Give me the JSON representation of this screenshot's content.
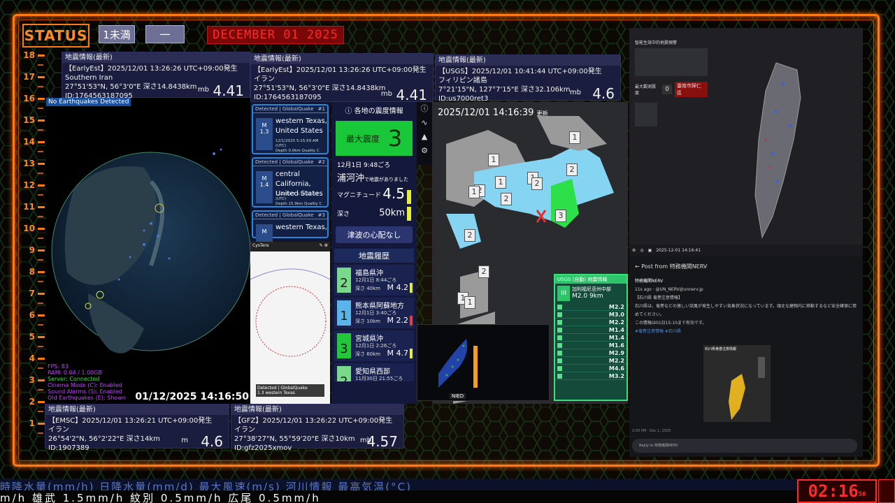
{
  "header": {
    "status_label": "STATUS",
    "level_label": "1未満",
    "dash_label": "一",
    "date": "DECEMBER 01 2025"
  },
  "ruler": [
    "18",
    "17",
    "16",
    "15",
    "14",
    "13",
    "12",
    "11",
    "10",
    "9",
    "8",
    "7",
    "6",
    "5",
    "4",
    "3",
    "2",
    "1"
  ],
  "quakes": [
    {
      "header": "地震情報(最新)",
      "source": "【EarlyEst】2025/12/01  13:26:26  UTC+09:00発生",
      "region": "Southern Iran",
      "coords": "27°51'53\"N,  56°3'0\"E  深さ14.8438km",
      "id": "ID:1764563187095",
      "mag_type": "mb",
      "mag": "4.41"
    },
    {
      "header": "地震情報(最新)",
      "source": "【EarlyEst】2025/12/01  13:26:26  UTC+09:00発生",
      "region": "イラン",
      "coords": "27°51'53\"N,  56°3'0\"E  深さ14.8438km",
      "id": "ID:1764563187095",
      "mag_type": "mb",
      "mag": "4.41"
    },
    {
      "header": "地震情報(最新)",
      "source": "【USGS】2025/12/01  10:41:44  UTC+09:00発生",
      "region": "フィリピン諸島",
      "coords": "7°21'15\"N,  127°7'15\"E  深さ32.106km",
      "id": "ID:us7000ret3",
      "mag_type": "mb",
      "mag": "4.6"
    },
    {
      "header": "地震情報(最新)",
      "source": "【EMSC】2025/12/01  13:26:21  UTC+09:00発生",
      "region": "イラン",
      "coords": "26°54'2\"N,  56°2'22\"E  深さ14km",
      "id": "ID:1907389",
      "mag_type": "m",
      "mag": "4.6"
    },
    {
      "header": "地震情報(最新)",
      "source": "【GFZ】2025/12/01  13:26:22  UTC+09:00発生",
      "region": "イラン",
      "coords": "27°38'27\"N,  55°59'20\"E  深さ10km",
      "id": "ID:gfz2025xmov",
      "mag_type": "mb",
      "mag": "4.57"
    }
  ],
  "globe": {
    "no_eq": "No Earthquakes Detected",
    "stats": [
      "FPS: 83",
      "RAM: 0.64 / 1.00GB",
      "Server: Connected",
      "Cinema Mode (C): Enabled",
      "Sound Alarms (S): Enabled",
      "Old Earthquakes (E): Shown"
    ],
    "time": "01/12/2025 14:16:50"
  },
  "globalquake": [
    {
      "head": "Detected | GlobalQuake",
      "num": "#1",
      "m": "M",
      "mag": "1.3",
      "place1": "western Texas,",
      "place2": "United States",
      "d1": "12/1/2025 5:15:59 AM (UTC)",
      "d2": "Depth 0.0km    Quality C"
    },
    {
      "head": "Detected | GlobalQuake",
      "num": "#2",
      "m": "M",
      "mag": "1.4",
      "place1": "central California,",
      "place2": "United States",
      "d1": "12/1/2025 5:10:21 AM (UTC)",
      "d2": "Depth 15.9km    Quality C"
    },
    {
      "head": "Detected | GlobalQuake",
      "num": "#3",
      "m": "M",
      "mag": "",
      "place1": "western Texas,",
      "place2": "",
      "d1": "",
      "d2": ""
    }
  ],
  "cystera": {
    "title": "CysTera",
    "foot_title": "Detected | GlobalQuake",
    "foot_place": "western Texas",
    "foot_mag": "1.3"
  },
  "jp": {
    "title": "各地の震度情報",
    "max_label": "最大震度",
    "max_value": "3",
    "date": "12月1日 9:48ごろ",
    "place": "浦河沖",
    "place_suffix": "で地震がありました",
    "mag_label": "マグニチュード",
    "mag_value": "4.5",
    "depth_label": "深さ",
    "depth_value": "50km",
    "tsunami": "津波の心配なし",
    "history_title": "地震履歴",
    "history": [
      {
        "shindo": "2",
        "name": "福島県沖",
        "time": "12月1日 8:44ごろ",
        "depth": "深さ  40km",
        "mag": "M 4.2",
        "color": "#7ad88a",
        "bar": "#e6ee3a"
      },
      {
        "shindo": "1",
        "name": "熊本県阿蘇地方",
        "time": "12月1日 3:40ごろ",
        "depth": "深さ  10km",
        "mag": "M 2.2",
        "color": "#5ab4ea",
        "bar": "#e04040"
      },
      {
        "shindo": "3",
        "name": "宮城県沖",
        "time": "12月1日 2:26ごろ",
        "depth": "深さ  60km",
        "mag": "M 4.7",
        "color": "#22c83a",
        "bar": "#e6ee3a"
      },
      {
        "shindo": "2",
        "name": "愛知県西部",
        "time": "11月30日 21:55ごろ",
        "depth": "",
        "mag": "",
        "color": "#7ad88a",
        "bar": "#e6ee3a"
      }
    ]
  },
  "hokkaido": {
    "time": "2025/12/01  14:16:39",
    "suffix": "更新",
    "labels": [
      "1",
      "1",
      "1",
      "1",
      "2",
      "2",
      "2",
      "2",
      "3",
      "1",
      "2",
      "2",
      "1",
      "1"
    ]
  },
  "nied": {
    "logo": "NIED"
  },
  "usgs": {
    "title": "USGS (自動) 地震情報",
    "place": "加利福尼亚州中部",
    "mag": "M2.0",
    "depth": "9km",
    "rows": [
      "M2.2",
      "M3.0",
      "M2.2",
      "M1.4",
      "M1.4",
      "M1.6",
      "M2.9",
      "M2.2",
      "M4.6",
      "M3.2"
    ]
  },
  "taiwan": {
    "title": "智能生效中的地震預警",
    "max_label": "最大觀測震度",
    "max_val": "0",
    "city": "臺南市歸仁區",
    "time": "2025-12-01 14:16:41"
  },
  "x_post": {
    "header": "Post from 特務機関NERV",
    "account": "特務機関NERV",
    "handle": "11s ago · @UN_NERV@unnerv.jp",
    "title": "【石川県 竜巻注意情報】",
    "body": "石川県は、竜巻などの激しい突風が発生しやすい気象状況になっています。頑丈な建物内に移動するなど安全確保に努めてください。",
    "valid": "この情報は01日15:10まで有効です。",
    "tags": "#竜巻注意情報 #石川県",
    "map_title": "石川県竜巻注意情報",
    "ts": "2:03 PM · Dec 1, 2025",
    "reply": "Reply to 特務機関NERV"
  },
  "ticker": {
    "line1": "時降水量(mm/h) 日降水量(mm/d)  最大風速(m/s)  河川情報   最高気温(°C)",
    "line2": "m/h   雄武 1.5mm/h    紋別 0.5mm/h   広尾 0.5mm/h"
  },
  "clock": {
    "hm": "02:16",
    "sec": "50"
  }
}
